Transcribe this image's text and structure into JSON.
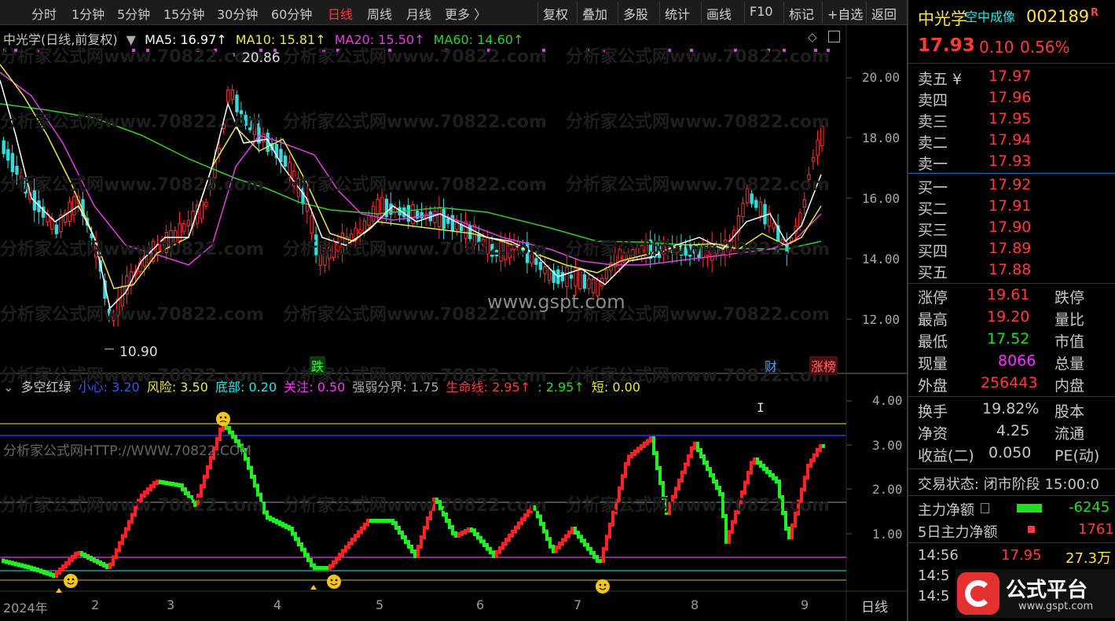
{
  "toolbar": {
    "periods": [
      "分时",
      "1分钟",
      "5分钟",
      "15分钟",
      "30分钟",
      "60分钟",
      "日线",
      "周线",
      "月线",
      "更多 〉"
    ],
    "active_period": "日线",
    "buttons": [
      "复权",
      "叠加",
      "多股",
      "统计",
      "画线",
      "F10",
      "标记",
      "+自选",
      "返回"
    ]
  },
  "main": {
    "stock_label": "中光学(日线,前复权)",
    "ma5": "MA5: 16.97↑",
    "ma10": "MA10: 15.81↑",
    "ma20": "MA20: 15.50↑",
    "ma60": "MA60: 14.60↑",
    "high_marker": "20.86",
    "low_marker": "10.90",
    "watermark_site": "www.gspt.com",
    "watermark_repeat": "分析家公式网www.70822.com",
    "tag_die": "跌",
    "tag_cai": "财",
    "tag_zhangbang": "涨榜",
    "price_axis": [
      "20.00",
      "18.00",
      "16.00",
      "14.00",
      "12.00"
    ],
    "colors": {
      "ma5": "#ffffff",
      "ma10": "#e8e84a",
      "ma20": "#e040e0",
      "ma60": "#33cc33",
      "up": "#ff3333",
      "down": "#33dddd"
    }
  },
  "sub": {
    "indicator_name": "多空红绿",
    "xiaoxin": "小心: 3.20",
    "fengxian": "风险: 3.50",
    "dibu": "底部: 0.20",
    "guanzhu": "关注: 0.50",
    "qiangruo": "强弱分界: 1.75",
    "shengming": "生命线: 2.95↑",
    "colon": ": 2.95↑",
    "duan": "短: 0.00",
    "sub_watermark": "分析家公式网HTTP://WWW.70822.COM",
    "value_axis": [
      "4.00",
      "3.00",
      "2.00",
      "1.00"
    ]
  },
  "xaxis": {
    "labels": [
      "2024年",
      "2",
      "3",
      "4",
      "5",
      "6",
      "7",
      "8",
      "9"
    ],
    "period_label": "日线"
  },
  "quote": {
    "name": "中光学",
    "name_sub": "空中成像",
    "code": "002189",
    "r_badge": "R",
    "price": "17.93",
    "change": "0.10",
    "change_pct": "0.56%",
    "asks": [
      {
        "label": "卖五 ¥",
        "price": "17.97"
      },
      {
        "label": "卖四",
        "price": "17.96"
      },
      {
        "label": "卖三",
        "price": "17.95"
      },
      {
        "label": "卖二",
        "price": "17.94"
      },
      {
        "label": "卖一",
        "price": "17.93"
      }
    ],
    "bids": [
      {
        "label": "买一",
        "price": "17.92"
      },
      {
        "label": "买二",
        "price": "17.91"
      },
      {
        "label": "买三",
        "price": "17.90"
      },
      {
        "label": "买四",
        "price": "17.89"
      },
      {
        "label": "买五",
        "price": "17.88"
      }
    ],
    "stats": [
      {
        "l1": "涨停",
        "v1": "19.61",
        "l2": "跌停"
      },
      {
        "l1": "最高",
        "v1": "19.20",
        "l2": "量比"
      },
      {
        "l1": "最低",
        "v1": "17.52",
        "l2": "市值"
      },
      {
        "l1": "现量",
        "v1": "8066",
        "l2": "总量"
      },
      {
        "l1": "外盘",
        "v1": "256443",
        "l2": "内盘"
      }
    ],
    "fin": [
      {
        "l1": "换手",
        "v1": "19.82%",
        "l2": "股本"
      },
      {
        "l1": "净资",
        "v1": "4.25",
        "l2": "流通"
      },
      {
        "l1": "收益(二)",
        "v1": "0.050",
        "l2": "PE(动)"
      }
    ],
    "trade_status": "交易状态: 闭市阶段 15:00:0",
    "main_net_label": "主力净额",
    "main_net_value": "-6245",
    "main_net5_label": "5日主力净额",
    "main_net5_value": "1761",
    "ticks": [
      {
        "time": "14:56",
        "price": "17.95",
        "vol": "27.3万"
      },
      {
        "time": "14:5",
        "price": "",
        "vol": ""
      },
      {
        "time": "14:5",
        "price": "",
        "vol": ""
      }
    ],
    "brand": "公式平台",
    "brand_url": "www.gspt.com"
  }
}
